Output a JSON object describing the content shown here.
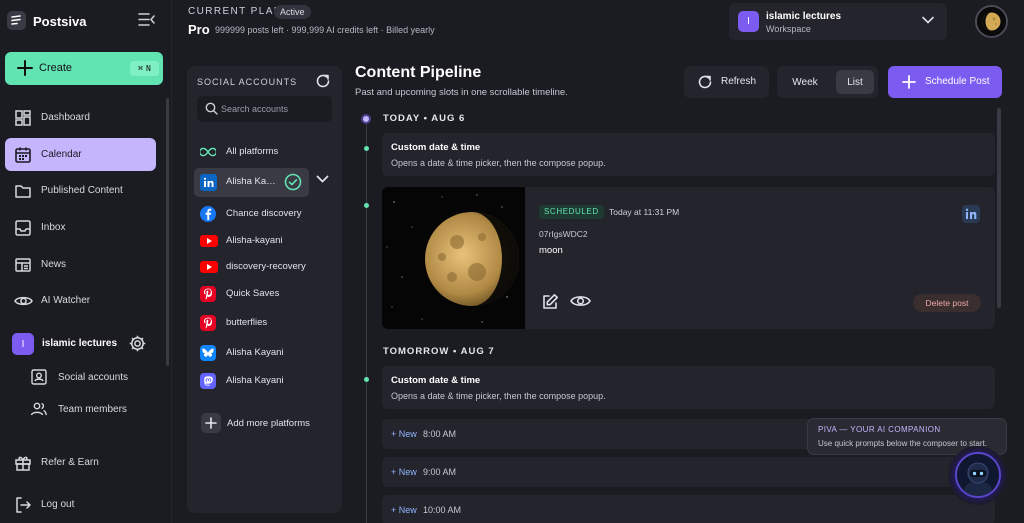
{
  "app": {
    "name": "Postsiva"
  },
  "sidebar": {
    "create": {
      "label": "Create",
      "shortcut_mod": "⌘",
      "shortcut_key": "N"
    },
    "items": [
      {
        "label": "Dashboard"
      },
      {
        "label": "Calendar"
      },
      {
        "label": "Published Content"
      },
      {
        "label": "Inbox"
      },
      {
        "label": "News"
      },
      {
        "label": "AI Watcher"
      }
    ],
    "workspace": {
      "initial": "I",
      "name": "islamic lectures"
    },
    "sub_items": [
      {
        "label": "Social accounts"
      },
      {
        "label": "Team members"
      }
    ],
    "refer": {
      "label": "Refer & Earn"
    },
    "logout": {
      "label": "Log out"
    }
  },
  "header": {
    "plan_label": "CURRENT PLAN",
    "plan_status": "Active",
    "plan_name": "Pro",
    "plan_detail": "999999 posts left · 999,999 AI credits left · Billed yearly",
    "workspace_initial": "I",
    "workspace_name": "islamic lectures",
    "workspace_type": "Workspace"
  },
  "social": {
    "title": "SOCIAL ACCOUNTS",
    "search_placeholder": "Search accounts",
    "accounts": [
      {
        "label": "All platforms",
        "platform": "all"
      },
      {
        "label": "Alisha Kayani",
        "platform": "linkedin"
      },
      {
        "label": "Chance discovery",
        "platform": "facebook"
      },
      {
        "label": "Alisha-kayani",
        "platform": "youtube"
      },
      {
        "label": "discovery-recovery",
        "platform": "youtube"
      },
      {
        "label": "Quick Saves",
        "platform": "pinterest"
      },
      {
        "label": "butterflies",
        "platform": "pinterest"
      },
      {
        "label": "Alisha Kayani",
        "platform": "bluesky"
      },
      {
        "label": "Alisha Kayani",
        "platform": "mastodon"
      }
    ],
    "add_label": "Add more platforms"
  },
  "pipeline": {
    "title": "Content Pipeline",
    "subtitle": "Past and upcoming slots in one scrollable timeline.",
    "refresh_label": "Refresh",
    "view_week": "Week",
    "view_list": "List",
    "active_view": "List",
    "schedule_label": "Schedule Post",
    "today_label": "TODAY • AUG 6",
    "tomorrow_label": "TOMORROW • AUG 7",
    "custom_slot": {
      "title": "Custom date & time",
      "desc": "Opens a date & time picker, then the compose popup."
    },
    "post": {
      "status": "SCHEDULED",
      "time": "Today at 11:31 PM",
      "id": "07rIgsWDC2",
      "text": "moon",
      "platform": "linkedin-icon",
      "delete_label": "Delete post"
    },
    "new_slots": [
      {
        "plus": "+ New",
        "time": "8:00 AM"
      },
      {
        "plus": "+ New",
        "time": "9:00 AM"
      },
      {
        "plus": "+ New",
        "time": "10:00 AM"
      }
    ]
  },
  "assistant": {
    "title": "PIVA — YOUR AI COMPANION",
    "text": "Use quick prompts below the composer to start."
  },
  "colors": {
    "accent": "#7c5cf0",
    "create": "#62e3b2",
    "active_nav": "#c4b5fd",
    "bg": "#1b1b22",
    "panel": "#24242c"
  }
}
